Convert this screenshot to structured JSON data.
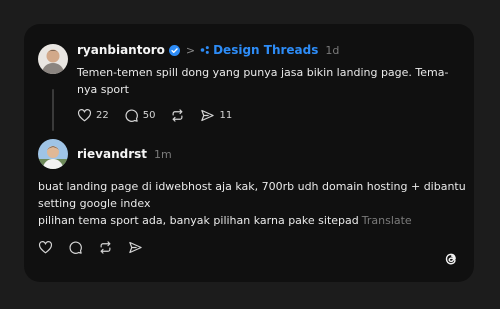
{
  "post": {
    "username": "ryanbiantoro",
    "separator": ">",
    "topic": "Design Threads",
    "time": "1d",
    "text_line1": "Temen-temen spill dong yang punya jasa bikin landing page. Tema-",
    "text_line2": "nya sport",
    "likes": "22",
    "comments": "50",
    "shares": "11",
    "icons": [
      "heart-icon",
      "comment-icon",
      "repost-icon",
      "share-icon"
    ]
  },
  "reply": {
    "username": "rievandrst",
    "time": "1m",
    "text_line1": "buat landing page di idwebhost aja kak, 700rb udh domain hosting + dibantu",
    "text_line2": "setting google index",
    "text_line3": "pilihan tema sport ada, banyak pilihan karna pake sitepad",
    "translate": "Translate",
    "icons": [
      "heart-icon",
      "comment-icon",
      "repost-icon",
      "share-icon"
    ]
  },
  "colors": {
    "background": "#1c1c1c",
    "card": "#101010",
    "accent": "#2d8cf7",
    "muted": "#7a7a7a"
  },
  "logo": "threads-logo-icon"
}
